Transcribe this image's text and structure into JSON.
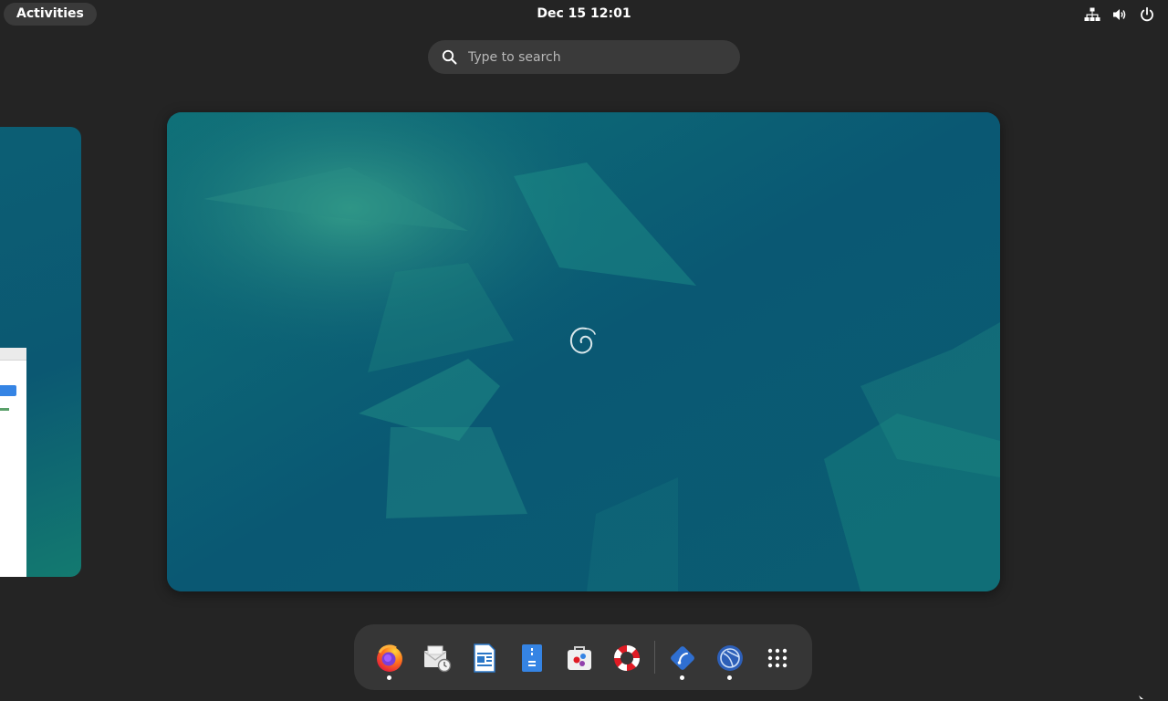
{
  "topbar": {
    "activities_label": "Activities",
    "clock": "Dec 15  12:01",
    "tray_icons": [
      "network-icon",
      "volume-icon",
      "power-icon"
    ]
  },
  "search": {
    "placeholder": "Type to search",
    "icon": "search-icon"
  },
  "workspaces": [
    {
      "name": "workspace-1",
      "contents": "browser window"
    },
    {
      "name": "workspace-2",
      "contents": "empty desktop",
      "logo": "debian-swirl"
    }
  ],
  "dash": {
    "items": [
      {
        "icon": "firefox-icon",
        "app": "Firefox",
        "running": true
      },
      {
        "icon": "evolution-mail-icon",
        "app": "Evolution",
        "running": false
      },
      {
        "icon": "libreoffice-writer-icon",
        "app": "LibreOffice Writer",
        "running": false
      },
      {
        "icon": "text-editor-icon",
        "app": "Text Editor",
        "running": false
      },
      {
        "icon": "software-icon",
        "app": "Software",
        "running": false
      },
      {
        "icon": "help-icon",
        "app": "Help",
        "running": false
      },
      {
        "icon": "diamond-app-icon",
        "app": "App",
        "running": true
      },
      {
        "icon": "globe-app-icon",
        "app": "App",
        "running": true
      }
    ],
    "show_apps_icon": "app-grid-icon"
  },
  "colors": {
    "panel": "#242424",
    "search_bg": "#3a3a3a",
    "dash_bg": "#363636",
    "wallpaper": "#0a5873",
    "accent": "#3584e4"
  }
}
